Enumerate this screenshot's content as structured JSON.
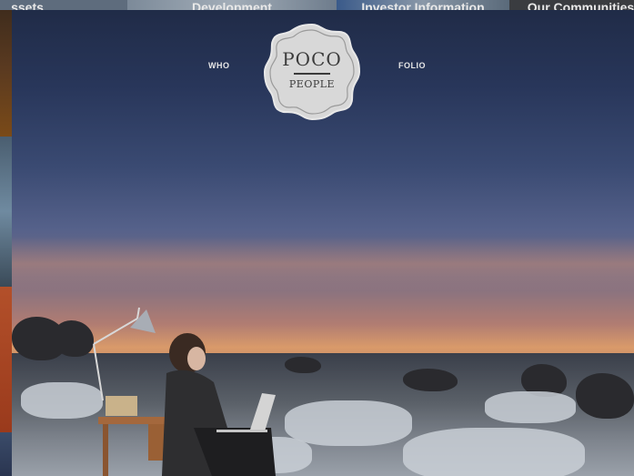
{
  "top_nav": {
    "items": [
      {
        "label": "ssets"
      },
      {
        "label": "Development"
      },
      {
        "label": "Investor Information"
      },
      {
        "label": "Our Communities"
      }
    ]
  },
  "nav": {
    "left_link": "WHO",
    "right_link": "FOLIO"
  },
  "logo": {
    "line1": "POCO",
    "line2": "PEOPLE"
  },
  "colors": {
    "logo_fill": "#d8d8d8",
    "logo_text": "#3b3b3b",
    "nav_text": "#e6e6e6"
  }
}
